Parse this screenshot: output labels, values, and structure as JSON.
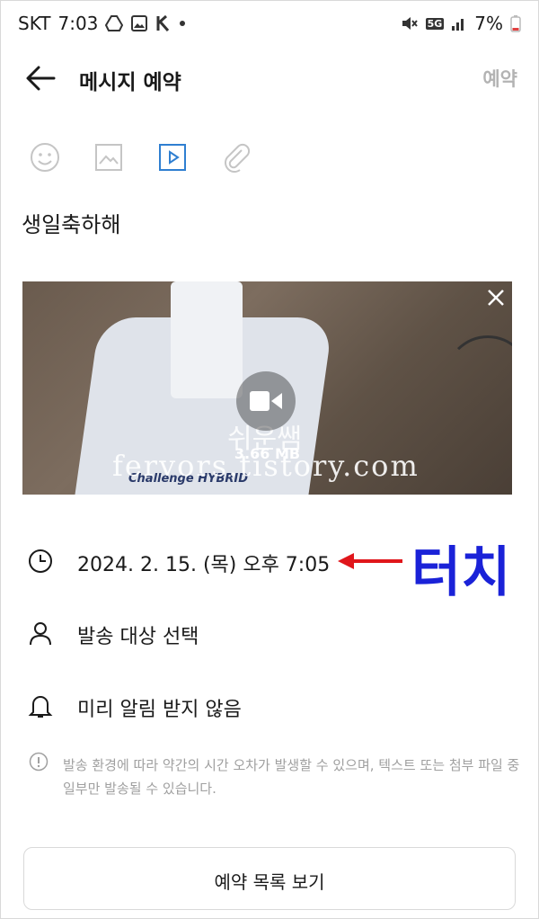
{
  "status_bar": {
    "carrier": "SKT",
    "time": "7:03",
    "network": "5G",
    "battery": "7%"
  },
  "app_bar": {
    "title": "메시지 예약",
    "action_label": "예약"
  },
  "toolbar": {
    "icons": [
      "emoji-icon",
      "image-icon",
      "video-icon",
      "attach-icon"
    ]
  },
  "message": {
    "text": "생일축하해"
  },
  "attachment": {
    "file_size": "3.66 MB",
    "watermark_korean": "쉬운쌤",
    "watermark_url": "fervors.tistory.com",
    "brand_text": "Challenge HYBRID"
  },
  "options": {
    "datetime": "2024. 2. 15. (목) 오후 7:05",
    "recipient": "발송 대상 선택",
    "reminder": "미리 알림 받지 않음"
  },
  "annotation": {
    "label": "터치",
    "color": "#1a22d8",
    "arrow_color": "#e0161b"
  },
  "notice": {
    "text": "발송 환경에 따라 약간의 시간 오차가 발생할 수 있으며, 텍스트 또는 첨부 파일 중 일부만 발송될 수 있습니다."
  },
  "footer": {
    "button_label": "예약 목록 보기"
  },
  "colors": {
    "accent": "#2f7fd1",
    "muted": "#b3b3b3",
    "icon_gray": "#c5c5c5"
  }
}
